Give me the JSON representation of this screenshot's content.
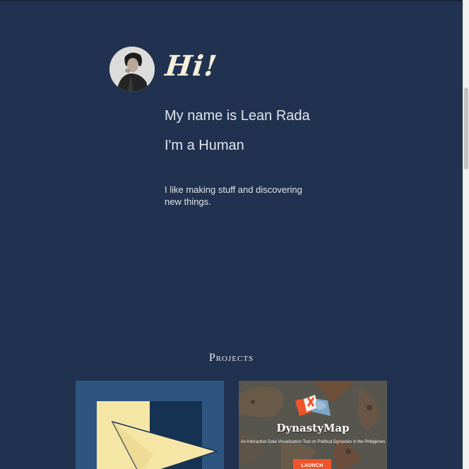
{
  "hero": {
    "greeting": "Hi!",
    "name_line": "My name is Lean Rada",
    "identity_line": "I'm a Human",
    "bio": "I like making stuff and discovering new things."
  },
  "projects": {
    "heading": "Projects",
    "cards": [
      {
        "icon": "paper-plane-icon"
      },
      {
        "title": "DynastyMap",
        "subtitle": "An Interactive Data Visualization Tool on Political Dynasties in the Philippines",
        "button_label": "LAUNCH",
        "icon": "map-flag-icon"
      }
    ]
  },
  "colors": {
    "background": "#213250",
    "greeting": "#f3efd9",
    "card1_bg": "#2e5580",
    "plane_light": "#f6e6a6",
    "plane_dark": "#163253",
    "launch": "#f0542a"
  }
}
